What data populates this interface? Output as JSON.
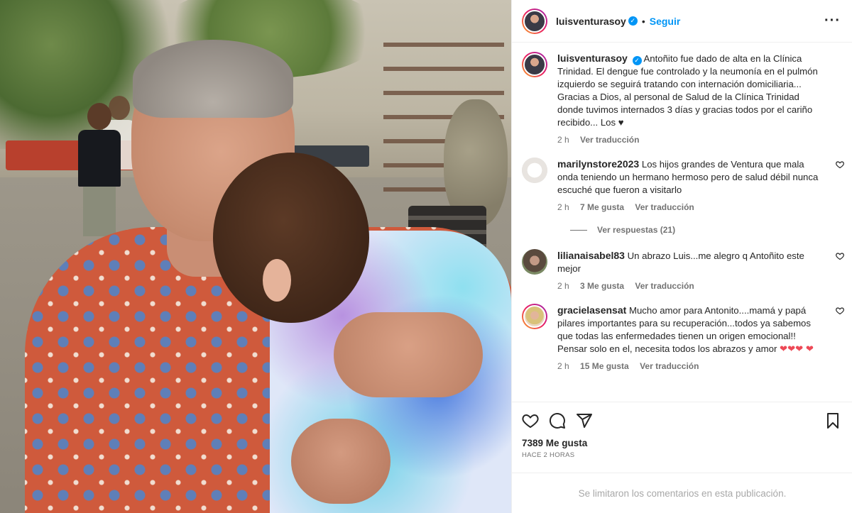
{
  "post": {
    "username": "luisventurasoy",
    "follow_label": "Seguir",
    "separator": "•"
  },
  "caption": {
    "username": "luisventurasoy",
    "text": "Antoñito fue dado de alta en la Clínica Trinidad. El dengue fue controlado y la neumonía en el pulmón izquierdo se seguirá tratando con internación domiciliaria... Gracias a Dios, al personal de Salud de la Clínica Trinidad donde tuvimos internados 3 días y gracias todos por el cariño recibido... Los ♥",
    "time": "2 h",
    "translate": "Ver traducción"
  },
  "comments": [
    {
      "username": "marilynstore2023",
      "text": "Los hijos grandes de Ventura que mala onda teniendo un hermano hermoso pero de salud débil nunca escuché que fueron a visitarlo",
      "time": "2 h",
      "likes": "7 Me gusta",
      "translate": "Ver traducción",
      "replies": "Ver respuestas (21)"
    },
    {
      "username": "lilianaisabel83",
      "text": "Un abrazo Luis...me alegro q Antoñito este mejor",
      "time": "2 h",
      "likes": "3 Me gusta",
      "translate": "Ver traducción"
    },
    {
      "username": "gracielasensat",
      "text": "Mucho amor para Antonito....mamá y papá pilares importantes para su recuperación...todos ya sabemos que todas las enfermedades tienen un origen emocional!! Pensar solo en el, necesita todos los abrazos y amor",
      "hearts": "❤❤❤ ❤",
      "time": "2 h",
      "likes": "15 Me gusta",
      "translate": "Ver traducción"
    }
  ],
  "actions": {
    "likes": "7389 Me gusta",
    "ago": "HACE 2 HORAS",
    "icons": [
      "heart-icon",
      "comment-icon",
      "share-icon",
      "save-icon"
    ]
  },
  "footer": {
    "notice": "Se limitaron los comentarios en esta publicación."
  },
  "colors": {
    "accent": "#0095f6",
    "text": "#262626",
    "muted": "#737373",
    "heart": "#ed4956"
  }
}
